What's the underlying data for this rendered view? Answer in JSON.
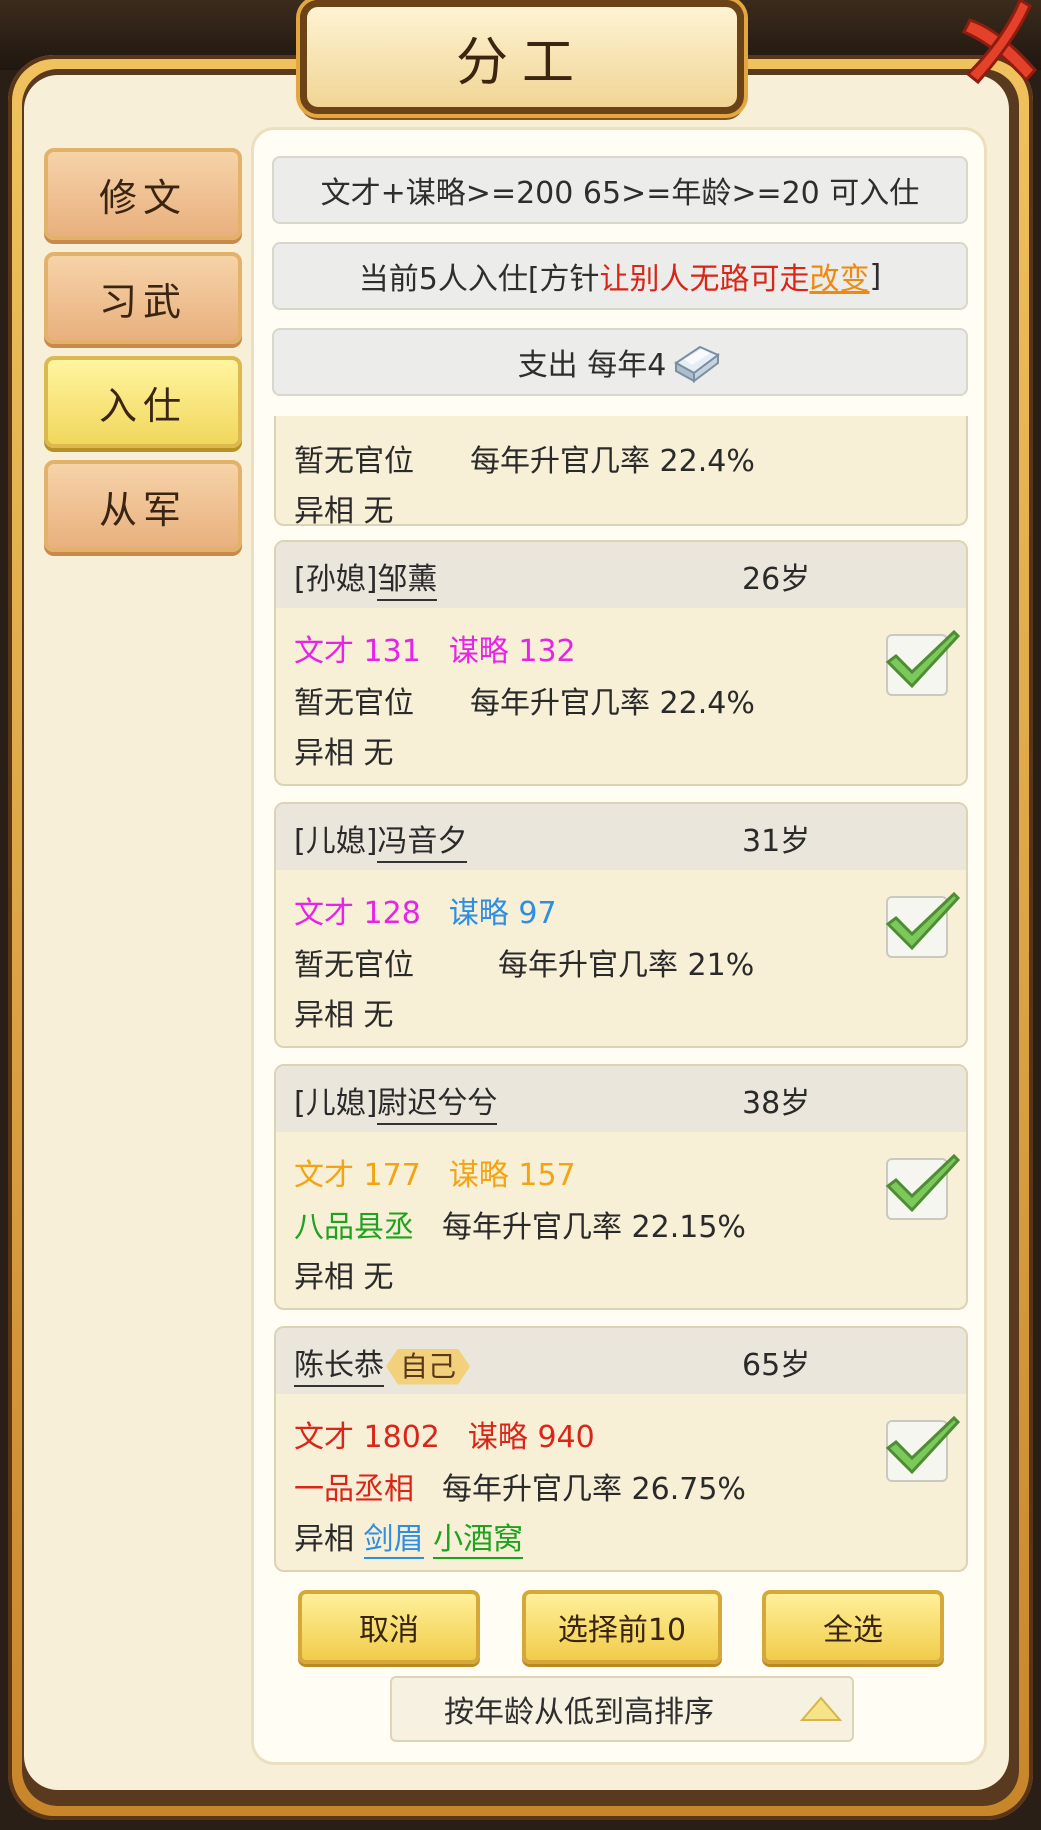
{
  "title": "分工",
  "tabs": [
    {
      "label": "修文",
      "active": false
    },
    {
      "label": "习武",
      "active": false
    },
    {
      "label": "入仕",
      "active": true
    },
    {
      "label": "从军",
      "active": false
    }
  ],
  "requirement_text": "文才+谋略>=200 65>=年龄>=20 可入仕",
  "status": {
    "prefix": "当前5人入仕[方针",
    "policy": "让别人无路可走",
    "change": "改变",
    "suffix": "]"
  },
  "expense": {
    "label": "支出 每年4",
    "icon": "silver-ingot-icon"
  },
  "partial_card": {
    "office": "暂无官位",
    "rate": "每年升官几率 22.4%",
    "trait_label": "异相",
    "trait": "无"
  },
  "members": [
    {
      "relation": "[孙媳]",
      "name": "邹薰",
      "age": "26岁",
      "wencai_label": "文才",
      "wencai": "131",
      "moulue_label": "谋略",
      "moulue": "132",
      "office": "暂无官位",
      "rate": "每年升官几率 22.4%",
      "trait_label": "异相",
      "trait": "无",
      "checked": true
    },
    {
      "relation": "[儿媳]",
      "name": "冯音夕",
      "age": "31岁",
      "wencai_label": "文才",
      "wencai": "128",
      "moulue_label": "谋略",
      "moulue": "97",
      "office": "暂无官位",
      "rate": "每年升官几率 21%",
      "trait_label": "异相",
      "trait": "无",
      "checked": true
    },
    {
      "relation": "[儿媳]",
      "name": "尉迟兮兮",
      "age": "38岁",
      "wencai_label": "文才",
      "wencai": "177",
      "moulue_label": "谋略",
      "moulue": "157",
      "office": "八品县丞",
      "rate": "每年升官几率 22.15%",
      "trait_label": "异相",
      "trait": "无",
      "checked": true
    },
    {
      "relation": "",
      "name": "陈长恭",
      "badge": "自己",
      "age": "65岁",
      "wencai_label": "文才",
      "wencai": "1802",
      "moulue_label": "谋略",
      "moulue": "940",
      "office": "一品丞相",
      "rate": "每年升官几率 26.75%",
      "trait_label": "异相",
      "traits": [
        "剑眉",
        "小酒窝"
      ],
      "checked": true
    }
  ],
  "buttons": {
    "cancel": "取消",
    "select_top": "选择前10",
    "select_all": "全选"
  },
  "sort_label": "按年龄从低到高排序",
  "colors": {
    "magenta": "#e524e8",
    "blue": "#2e8ee0",
    "gold": "#f2a413",
    "green": "#1fa21f",
    "red": "#d92618"
  }
}
